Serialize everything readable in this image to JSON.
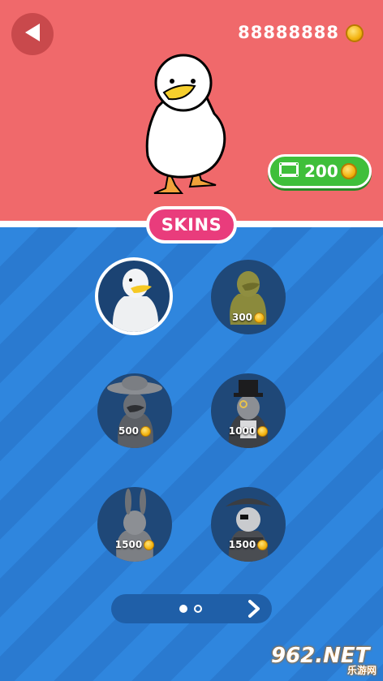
{
  "header": {
    "coin_balance": "88888888",
    "back_icon": "back-arrow-icon",
    "coin_icon": "gold-coin-icon"
  },
  "hero": {
    "icon": "white-duck-character"
  },
  "video_reward": {
    "amount": "200",
    "icon": "video-film-icon"
  },
  "tab": {
    "label": "SKINS"
  },
  "skins": [
    {
      "id": "duck-white",
      "price": "",
      "selected": true
    },
    {
      "id": "duck-olive",
      "price": "300"
    },
    {
      "id": "duck-mexican-hat",
      "price": "500"
    },
    {
      "id": "duck-gentleman",
      "price": "1000"
    },
    {
      "id": "duck-bunny",
      "price": "1500"
    },
    {
      "id": "duck-pirate",
      "price": "1500"
    }
  ],
  "pager": {
    "pages": 2,
    "current": 1
  },
  "watermark": {
    "text": "962.NET",
    "subtext": "乐游网"
  },
  "colors": {
    "top_bg": "#f0696b",
    "bottom_bg": "#2f86de",
    "tab_bg": "#e93c7c",
    "video_btn": "#3fbf3a"
  }
}
